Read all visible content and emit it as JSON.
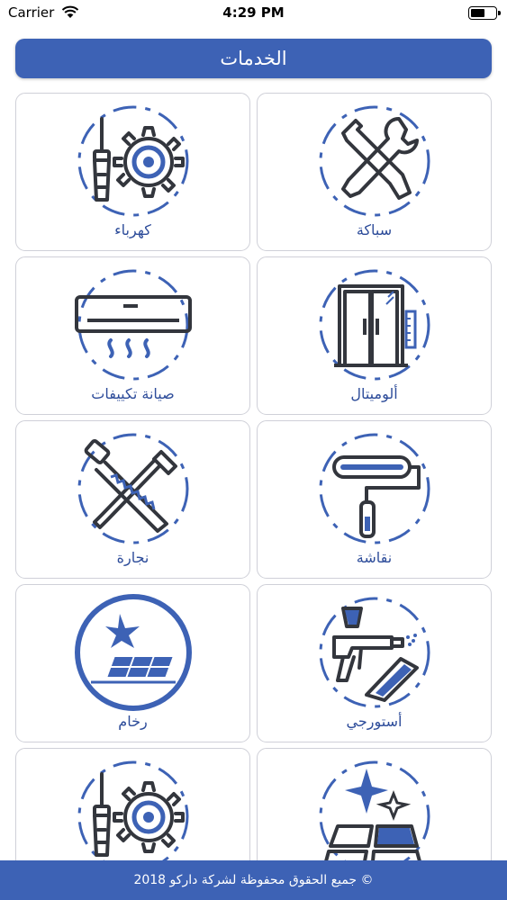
{
  "status_bar": {
    "carrier": "Carrier",
    "time": "4:29 PM"
  },
  "header": {
    "title": "الخدمات"
  },
  "services": [
    {
      "label": "سباكة",
      "icon": "plumbing-icon"
    },
    {
      "label": "كهرباء",
      "icon": "electricity-icon"
    },
    {
      "label": "ألوميتال",
      "icon": "aluminum-window-icon"
    },
    {
      "label": "صيانة تكييفات",
      "icon": "air-conditioner-icon"
    },
    {
      "label": "نقاشة",
      "icon": "paint-roller-icon"
    },
    {
      "label": "نجارة",
      "icon": "carpentry-icon"
    },
    {
      "label": "أستورجي",
      "icon": "spray-gun-icon"
    },
    {
      "label": "رخام",
      "icon": "marble-icon"
    },
    {
      "label": "",
      "icon": "tile-cleaning-icon"
    },
    {
      "label": "",
      "icon": "electricity-icon"
    }
  ],
  "footer": {
    "copyright": "جميع الحقوق محفوظة لشركة داركو 2018 ©"
  },
  "colors": {
    "primary": "#3d62b5",
    "label": "#2d4c9a",
    "icon_dark": "#33363d"
  }
}
